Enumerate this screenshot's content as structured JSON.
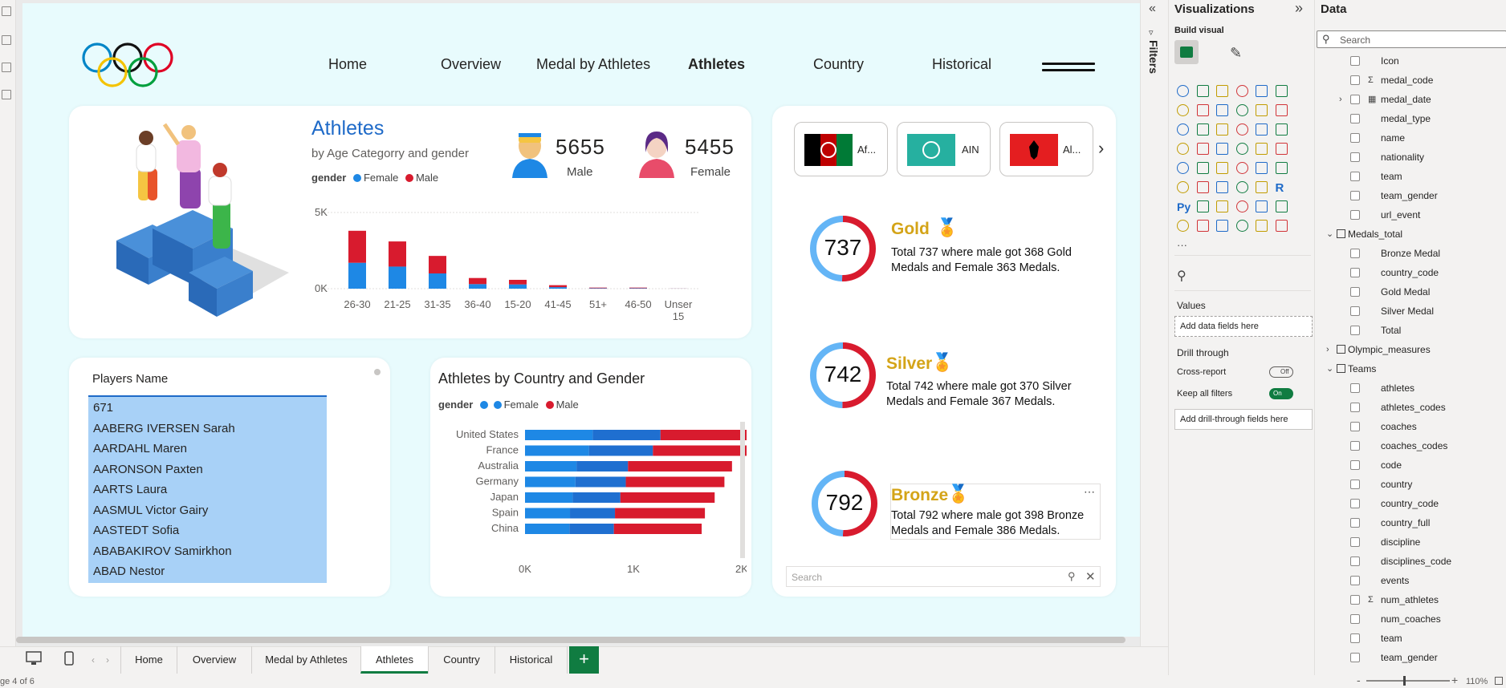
{
  "nav": {
    "items": [
      "Home",
      "Overview",
      "Medal by Athletes",
      "Athletes",
      "Country",
      "Historical"
    ],
    "active": "Athletes"
  },
  "athletes_card": {
    "title": "Athletes",
    "subtitle": "by Age Categorry and gender",
    "legend_label": "gender",
    "legend_female": "Female",
    "legend_male": "Male",
    "male_count": "5655",
    "male_label": "Male",
    "female_count": "5455",
    "female_label": "Female"
  },
  "players": {
    "header": "Players Name",
    "rows": [
      "671",
      "AABERG IVERSEN Sarah",
      "AARDAHL Maren",
      "AARONSON Paxten",
      "AARTS Laura",
      "AASMUL Victor Gairy",
      "AASTEDT Sofia",
      "ABABAKIROV Samirkhon",
      "ABAD Nestor"
    ]
  },
  "country_chart_card": {
    "title": "Athletes by Country and Gender",
    "legend_label": "gender",
    "legend_female": "Female",
    "legend_male": "Male"
  },
  "chart_data": [
    {
      "type": "bar",
      "title": "Athletes",
      "subtitle": "by Age Categorry and gender",
      "categories": [
        "26-30",
        "21-25",
        "31-35",
        "36-40",
        "15-20",
        "41-45",
        "51+",
        "46-50",
        "Unser 15"
      ],
      "series": [
        {
          "name": "Female",
          "values": [
            1700,
            1450,
            1000,
            300,
            280,
            100,
            30,
            30,
            5
          ]
        },
        {
          "name": "Male",
          "values": [
            2100,
            1650,
            1150,
            400,
            300,
            130,
            40,
            40,
            5
          ]
        }
      ],
      "ylim": [
        0,
        5000
      ],
      "yticks": [
        "0K",
        "5K"
      ],
      "stacked": true
    },
    {
      "type": "bar",
      "orientation": "horizontal",
      "title": "Athletes by Country and Gender",
      "categories": [
        "United States",
        "France",
        "Australia",
        "Germany",
        "Japan",
        "Spain",
        "China"
      ],
      "series": [
        {
          "name": "Female",
          "values": [
            1250,
            1180,
            950,
            930,
            880,
            830,
            820
          ]
        },
        {
          "name": "Male",
          "values": [
            1250,
            1200,
            960,
            910,
            870,
            830,
            810
          ]
        }
      ],
      "xlim": [
        0,
        2000
      ],
      "xticks": [
        "0K",
        "1K",
        "2K"
      ],
      "stacked": true
    },
    {
      "type": "pie",
      "title": "Gold",
      "values": [
        368,
        363
      ],
      "series": [
        "Male",
        "Female"
      ],
      "total": 737
    },
    {
      "type": "pie",
      "title": "Silver",
      "values": [
        370,
        367
      ],
      "series": [
        "Male",
        "Female"
      ],
      "total": 742
    },
    {
      "type": "pie",
      "title": "Bronze",
      "values": [
        398,
        386
      ],
      "series": [
        "Male",
        "Female"
      ],
      "total": 792
    }
  ],
  "medals": [
    {
      "title": "Gold",
      "total": "737",
      "desc": "Total 737 where male got 368 Gold Medals and Female 363 Medals."
    },
    {
      "title": "Silver",
      "total": "742",
      "desc": "Total 742 where male got 370 Silver Medals and Female 367 Medals."
    },
    {
      "title": "Bronze",
      "total": "792",
      "desc": "Total 792 where male got 398 Bronze Medals and Female 386 Medals."
    }
  ],
  "country_slicer": {
    "items": [
      "Af...",
      "AIN",
      "Al..."
    ],
    "search_placeholder": "Search"
  },
  "page_tabs": [
    "Home",
    "Overview",
    "Medal by Athletes",
    "Athletes",
    "Country",
    "Historical"
  ],
  "status": {
    "page": "ge 4 of 6",
    "zoom": "110%"
  },
  "filters_label": "Filters",
  "viz_pane": {
    "title": "Visualizations",
    "build_visual": "Build visual",
    "values_label": "Values",
    "add_data_fields": "Add data fields here",
    "drill_through": "Drill through",
    "cross_report": "Cross-report",
    "cross_report_state": "Off",
    "keep_all_filters": "Keep all filters",
    "keep_all_state": "On",
    "add_drill_fields": "Add drill-through fields here",
    "py_label": "Py",
    "r_label": "R"
  },
  "data_pane": {
    "title": "Data",
    "search_placeholder": "Search",
    "fields": [
      {
        "label": "Icon",
        "kind": "field"
      },
      {
        "label": "medal_code",
        "kind": "sigma"
      },
      {
        "label": "medal_date",
        "kind": "date"
      },
      {
        "label": "medal_type",
        "kind": "field"
      },
      {
        "label": "name",
        "kind": "field"
      },
      {
        "label": "nationality",
        "kind": "field"
      },
      {
        "label": "team",
        "kind": "field"
      },
      {
        "label": "team_gender",
        "kind": "field"
      },
      {
        "label": "url_event",
        "kind": "field"
      },
      {
        "label": "Medals_total",
        "kind": "table"
      },
      {
        "label": "Bronze Medal",
        "kind": "field"
      },
      {
        "label": "country_code",
        "kind": "field"
      },
      {
        "label": "Gold Medal",
        "kind": "field"
      },
      {
        "label": "Silver Medal",
        "kind": "field"
      },
      {
        "label": "Total",
        "kind": "field"
      },
      {
        "label": "Olympic_measures",
        "kind": "table-collapsed"
      },
      {
        "label": "Teams",
        "kind": "table"
      },
      {
        "label": "athletes",
        "kind": "field"
      },
      {
        "label": "athletes_codes",
        "kind": "field"
      },
      {
        "label": "coaches",
        "kind": "field"
      },
      {
        "label": "coaches_codes",
        "kind": "field"
      },
      {
        "label": "code",
        "kind": "field"
      },
      {
        "label": "country",
        "kind": "field"
      },
      {
        "label": "country_code",
        "kind": "field"
      },
      {
        "label": "country_full",
        "kind": "field"
      },
      {
        "label": "discipline",
        "kind": "field"
      },
      {
        "label": "disciplines_code",
        "kind": "field"
      },
      {
        "label": "events",
        "kind": "field"
      },
      {
        "label": "num_athletes",
        "kind": "sigma"
      },
      {
        "label": "num_coaches",
        "kind": "field"
      },
      {
        "label": "team",
        "kind": "field"
      },
      {
        "label": "team_gender",
        "kind": "field"
      }
    ]
  },
  "colors": {
    "female": "#1e88e5",
    "female_dark": "#1f6fd0",
    "male": "#d81b2e",
    "gold_text": "#d4a418",
    "accent_green": "#107c41"
  }
}
